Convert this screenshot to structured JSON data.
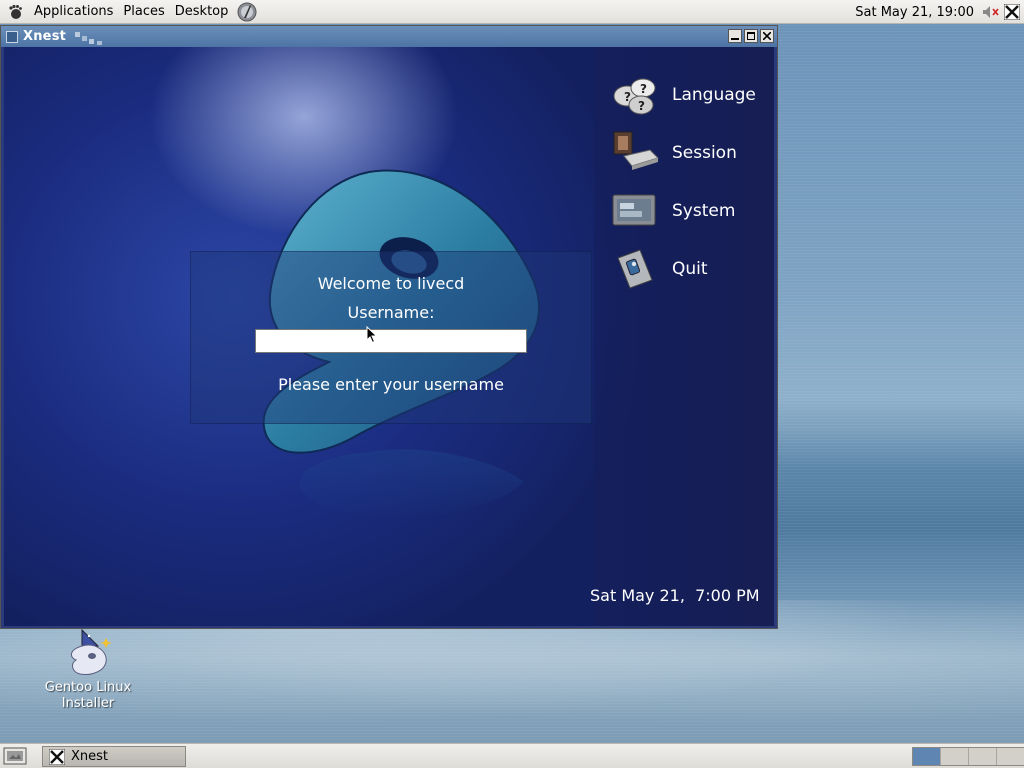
{
  "top_panel": {
    "menus": [
      "Applications",
      "Places",
      "Desktop"
    ],
    "clock": "Sat May 21, 19:00"
  },
  "window": {
    "title": "Xnest"
  },
  "gdm": {
    "welcome": "Welcome to livecd",
    "username_label": "Username:",
    "username_value": "",
    "hint": "Please enter your username",
    "menu": [
      {
        "label": "Language",
        "icon": "language-icon"
      },
      {
        "label": "Session",
        "icon": "session-icon"
      },
      {
        "label": "System",
        "icon": "system-icon"
      },
      {
        "label": "Quit",
        "icon": "quit-icon"
      }
    ],
    "clock": "Sat May 21,  7:00 PM"
  },
  "desktop": {
    "icon_label_line1": "Gentoo Linux",
    "icon_label_line2": "Installer"
  },
  "bottom_panel": {
    "task_label": "Xnest",
    "workspaces": 4,
    "active_workspace": 1
  },
  "colors": {
    "titlebar": "#5a7fb0",
    "gdm_background": "#1b2c80",
    "logo": "#3a8fb0"
  }
}
